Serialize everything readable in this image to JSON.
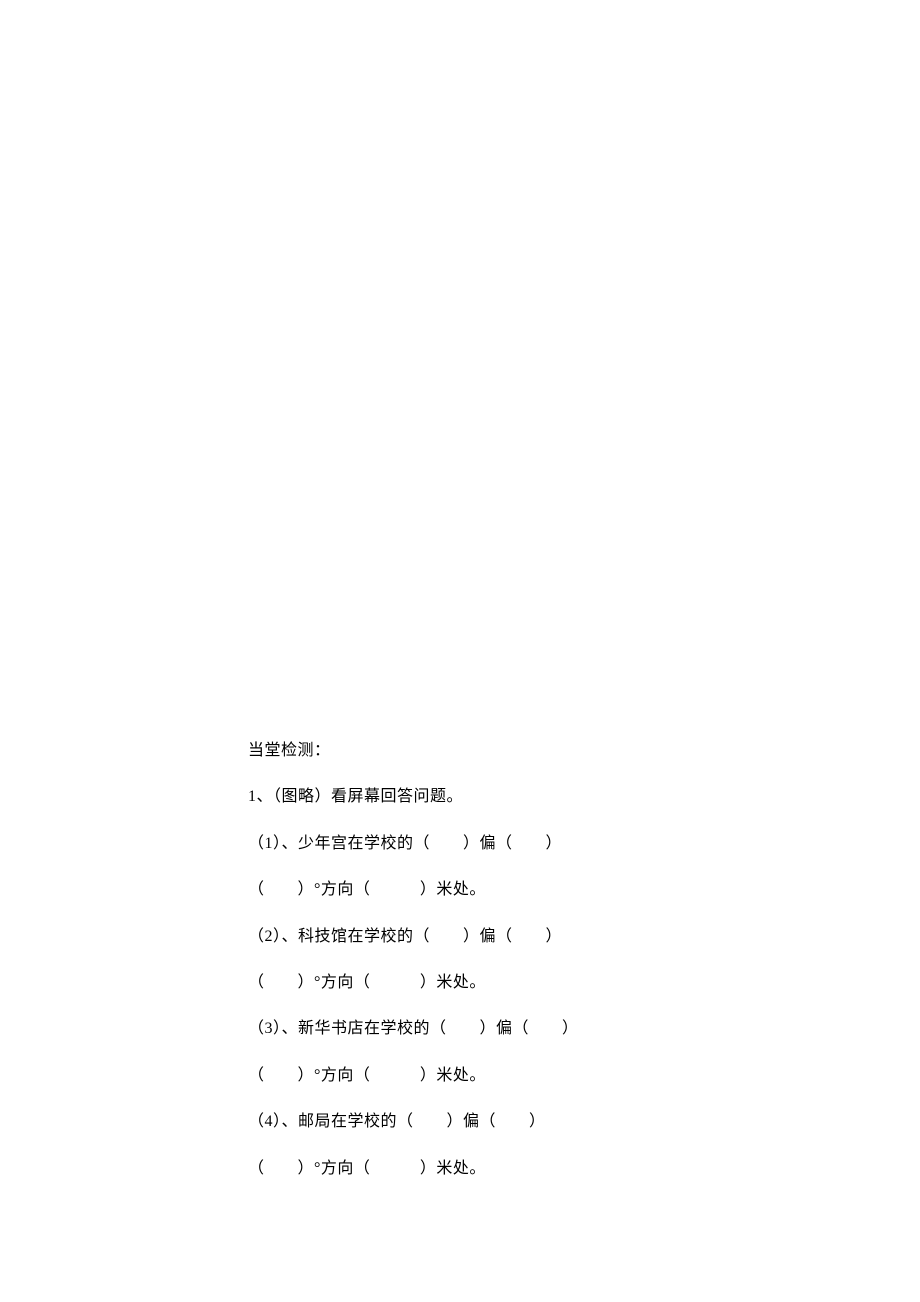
{
  "section_title": "当堂检测：",
  "question_intro": "1、（图略）看屏幕回答问题。",
  "items": [
    {
      "line1": "（1）、少年宫在学校的（　　）偏（　　）",
      "line2": "（　　）°方向（　　　）米处。"
    },
    {
      "line1": "（2）、科技馆在学校的（　　）偏（　　）",
      "line2": "（　　）°方向（　　　）米处。"
    },
    {
      "line1": "（3）、新华书店在学校的（　　）偏（　　）",
      "line2": "（　　）°方向（　　　）米处。"
    },
    {
      "line1": "（4）、邮局在学校的（　　）偏（　　）",
      "line2": "（　　）°方向（　　　）米处。"
    }
  ]
}
